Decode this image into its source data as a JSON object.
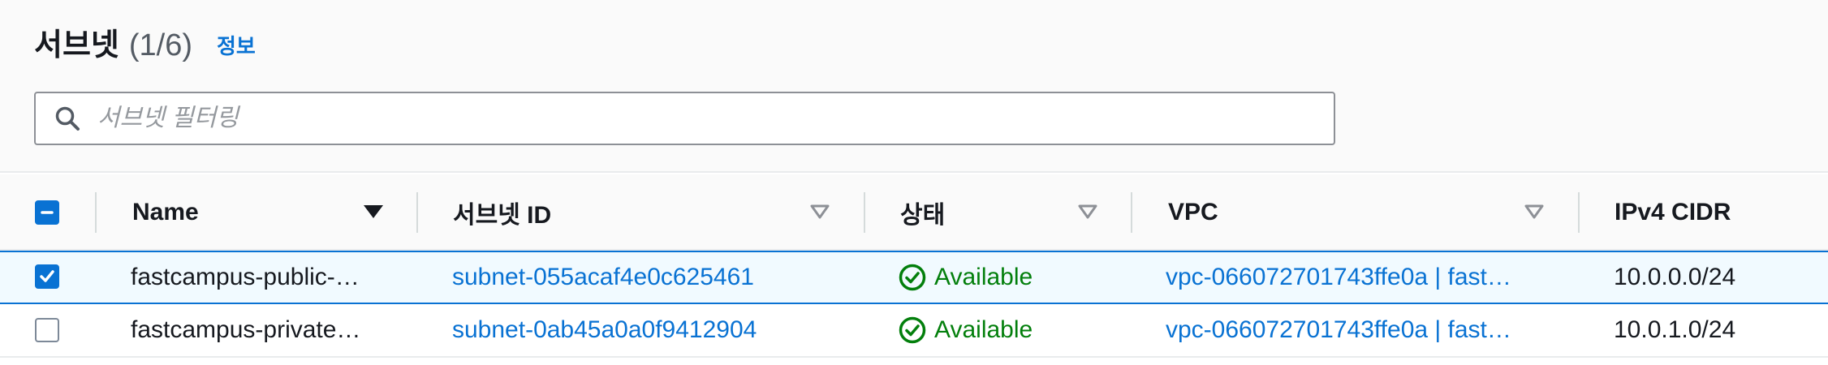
{
  "header": {
    "title": "서브넷",
    "count": "(1/6)",
    "info_link": "정보"
  },
  "search": {
    "placeholder": "서브넷 필터링",
    "value": ""
  },
  "table": {
    "columns": [
      {
        "label": "Name",
        "sort": "sorted-descending"
      },
      {
        "label": "서브넷 ID",
        "sort": "sortable"
      },
      {
        "label": "상태",
        "sort": "sortable"
      },
      {
        "label": "VPC",
        "sort": "sortable"
      },
      {
        "label": "IPv4 CIDR",
        "sort": "none"
      }
    ],
    "header_checkbox": "indeterminate",
    "rows": [
      {
        "selected": true,
        "name": "fastcampus-public-…",
        "subnet_id": "subnet-055acaf4e0c625461",
        "status": "Available",
        "vpc": "vpc-066072701743ffe0a | fast…",
        "cidr": "10.0.0.0/24"
      },
      {
        "selected": false,
        "name": "fastcampus-private…",
        "subnet_id": "subnet-0ab45a0a0f9412904",
        "status": "Available",
        "vpc": "vpc-066072701743ffe0a | fast…",
        "cidr": "10.0.1.0/24"
      }
    ]
  },
  "colors": {
    "link": "#0972d3",
    "status_available": "#037f0c",
    "selected_row_bg": "#f1faff",
    "header_bg": "#fafafa"
  },
  "icons": {
    "search": "search-icon",
    "sort_active": "caret-down-filled-icon",
    "sort_inactive": "caret-down-outline-icon",
    "status": "check-circle-icon"
  }
}
